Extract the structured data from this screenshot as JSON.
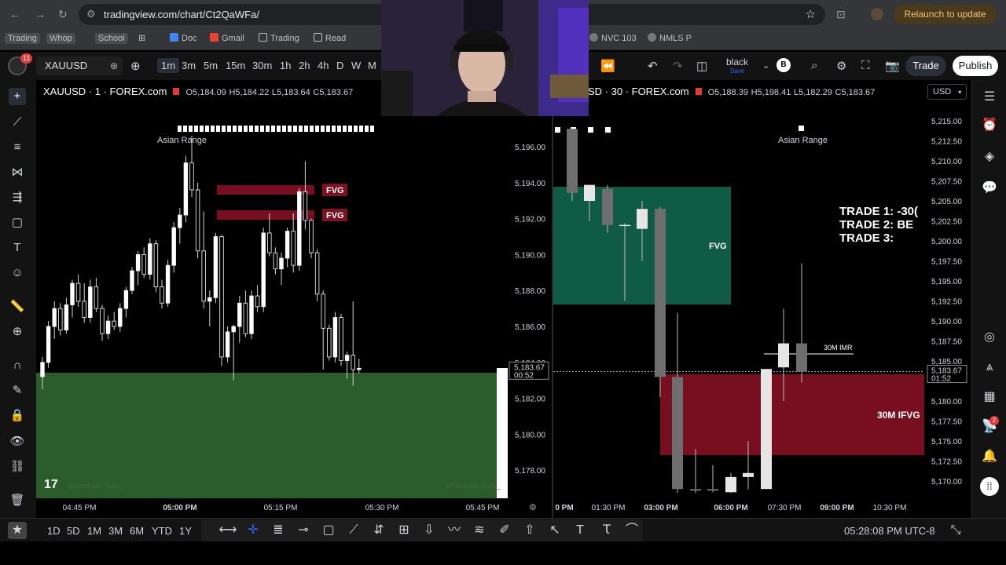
{
  "browser": {
    "url": "tradingview.com/chart/Ct2QaWFa/",
    "relaunch_label": "Relaunch to update",
    "bookmarks": [
      "Trading",
      "Whop",
      "School",
      "Doc",
      "Gmail",
      "Trading",
      "Read",
      "NVC 103",
      "NMLS P"
    ]
  },
  "toolbar": {
    "notification_count": "11",
    "symbol": "XAUUSD",
    "timeframes": [
      "1m",
      "3m",
      "5m",
      "15m",
      "30m",
      "1h",
      "2h",
      "4h",
      "D",
      "W",
      "M"
    ],
    "active_timeframe": "1m",
    "theme_name": "black",
    "theme_sub": "Save",
    "avatar_letter": "B",
    "trade_label": "Trade",
    "publish_label": "Publish"
  },
  "left_chart": {
    "title": "XAUUSD · 1 · FOREX.com",
    "open": "O5,184.09",
    "high": "H5,184.22",
    "low": "L5,183.64",
    "close": "C5,183.67",
    "price_labels": [
      "5,196.00",
      "5,194.00",
      "5,192.00",
      "5,190.00",
      "5,188.00",
      "5,186.00",
      "5,184.00",
      "5,182.00",
      "5,180.00",
      "5,178.00"
    ],
    "current_price": "5,183.67",
    "countdown": "00:52",
    "time_labels": [
      "04:45 PM",
      "05:00 PM",
      "05:15 PM",
      "05:30 PM",
      "05:45 PM"
    ],
    "asian_range_label": "Asian Range",
    "fvg_labels": [
      "FVG",
      "FVG"
    ],
    "watermark": "@Nephew_Sam_"
  },
  "right_chart": {
    "title": "XAUUSD · 30 · FOREX.com",
    "title_visible": "SD · 30 · FOREX.com",
    "open": "O5,188.39",
    "high": "H5,198.41",
    "low": "L5,182.29",
    "close": "C5,183.67",
    "currency": "USD",
    "price_labels": [
      "5,215.00",
      "5,212.50",
      "5,210.00",
      "5,207.50",
      "5,205.00",
      "5,202.50",
      "5,200.00",
      "5,197.50",
      "5,195.00",
      "5,192.50",
      "5,190.00",
      "5,187.50",
      "5,185.00",
      "5,180.00",
      "5,177.50",
      "5,175.00",
      "5,172.50",
      "5,170.00"
    ],
    "current_price": "5,183.67",
    "countdown": "01:52",
    "time_labels": [
      "0 PM",
      "01:30 PM",
      "03:00 PM",
      "06:00 PM",
      "07:30 PM",
      "09:00 PM",
      "10:30 PM"
    ],
    "asian_range_label": "Asian Range",
    "fvg_label": "FVG",
    "ifvg_label": "30M IFVG",
    "imr_label": "30M IMR",
    "trade_notes": [
      "TRADE 1: -30(",
      "TRADE 2: BE",
      "TRADE 3:"
    ]
  },
  "bottom": {
    "ranges": [
      "1D",
      "5D",
      "1M",
      "3M",
      "6M",
      "YTD",
      "1Y"
    ],
    "clock": "05:28:08 PM UTC-8"
  },
  "colors": {
    "bearish_zone": "#780f20",
    "bullish_zone": "#0f5b45",
    "green_zone": "#2a5d2b",
    "accent": "#2962ff"
  }
}
